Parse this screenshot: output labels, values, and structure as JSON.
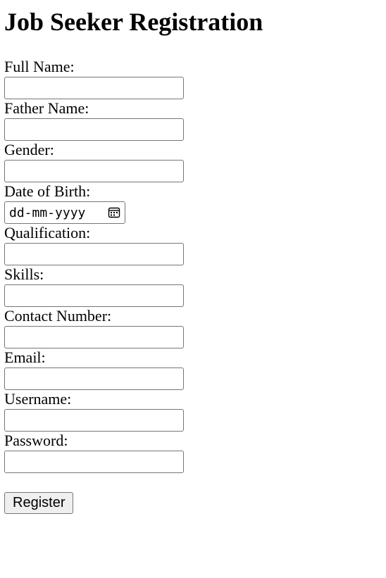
{
  "page": {
    "title": "Job Seeker Registration"
  },
  "form": {
    "fields": {
      "full_name": {
        "label": "Full Name:",
        "value": ""
      },
      "father_name": {
        "label": "Father Name:",
        "value": ""
      },
      "gender": {
        "label": "Gender:",
        "value": ""
      },
      "dob": {
        "label": "Date of Birth:",
        "placeholder": "dd-mm-yyyy"
      },
      "qualification": {
        "label": "Qualification:",
        "value": ""
      },
      "skills": {
        "label": "Skills:",
        "value": ""
      },
      "contact": {
        "label": "Contact Number:",
        "value": ""
      },
      "email": {
        "label": "Email:",
        "value": ""
      },
      "username": {
        "label": "Username:",
        "value": ""
      },
      "password": {
        "label": "Password:",
        "value": ""
      }
    },
    "submit_label": "Register"
  },
  "icons": {
    "dob_picker": "calendar-icon"
  },
  "colors": {
    "input_border": "#767676",
    "button_bg": "#efefef",
    "text": "#000000",
    "background": "#ffffff"
  }
}
